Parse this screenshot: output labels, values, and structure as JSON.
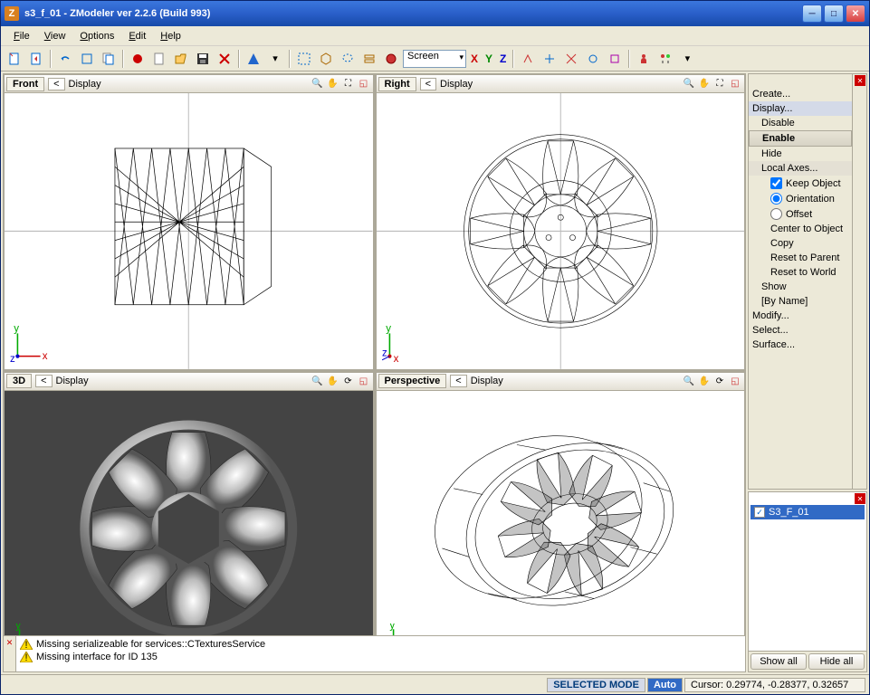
{
  "window": {
    "title": "s3_f_01 - ZModeler ver 2.2.6 (Build 993)"
  },
  "menubar": [
    "File",
    "View",
    "Options",
    "Edit",
    "Help"
  ],
  "toolbar": {
    "combo": "Screen"
  },
  "viewports": {
    "front": {
      "title": "Front",
      "nav": "<",
      "disp": "Display"
    },
    "right": {
      "title": "Right",
      "nav": "<",
      "disp": "Display"
    },
    "three_d": {
      "title": "3D",
      "nav": "<",
      "disp": "Display"
    },
    "persp": {
      "title": "Perspective",
      "nav": "<",
      "disp": "Display"
    }
  },
  "commands": {
    "items": [
      {
        "label": "Create...",
        "lvl": 0
      },
      {
        "label": "Display...",
        "lvl": 0,
        "hl": true
      },
      {
        "label": "Disable",
        "lvl": 1
      },
      {
        "label": "Enable",
        "lvl": 1,
        "sel": true
      },
      {
        "label": "Hide",
        "lvl": 1
      },
      {
        "label": "Local Axes...",
        "lvl": 1,
        "hl2": true
      },
      {
        "label": "Keep Object",
        "lvl": 2,
        "check": true
      },
      {
        "label": "Orientation",
        "lvl": 2,
        "radio": true,
        "on": true
      },
      {
        "label": "Offset",
        "lvl": 2,
        "radio": true
      },
      {
        "label": "Center to Object",
        "lvl": 2
      },
      {
        "label": "Copy",
        "lvl": 2
      },
      {
        "label": "Reset to Parent",
        "lvl": 2
      },
      {
        "label": "Reset to World",
        "lvl": 2
      },
      {
        "label": "Show",
        "lvl": 1
      },
      {
        "label": "[By Name]",
        "lvl": 1
      },
      {
        "label": "Modify...",
        "lvl": 0
      },
      {
        "label": "Select...",
        "lvl": 0
      },
      {
        "label": "Surface...",
        "lvl": 0
      }
    ]
  },
  "objects": {
    "items": [
      {
        "name": "S3_F_01",
        "checked": true,
        "sel": true
      }
    ],
    "show_all": "Show all",
    "hide_all": "Hide all"
  },
  "console": {
    "lines": [
      "Missing serializeable for services::CTexturesService",
      "Missing interface for ID 135"
    ]
  },
  "status": {
    "mode": "SELECTED MODE",
    "auto": "Auto",
    "cursor": "Cursor: 0.29774, -0.28377, 0.32657"
  }
}
